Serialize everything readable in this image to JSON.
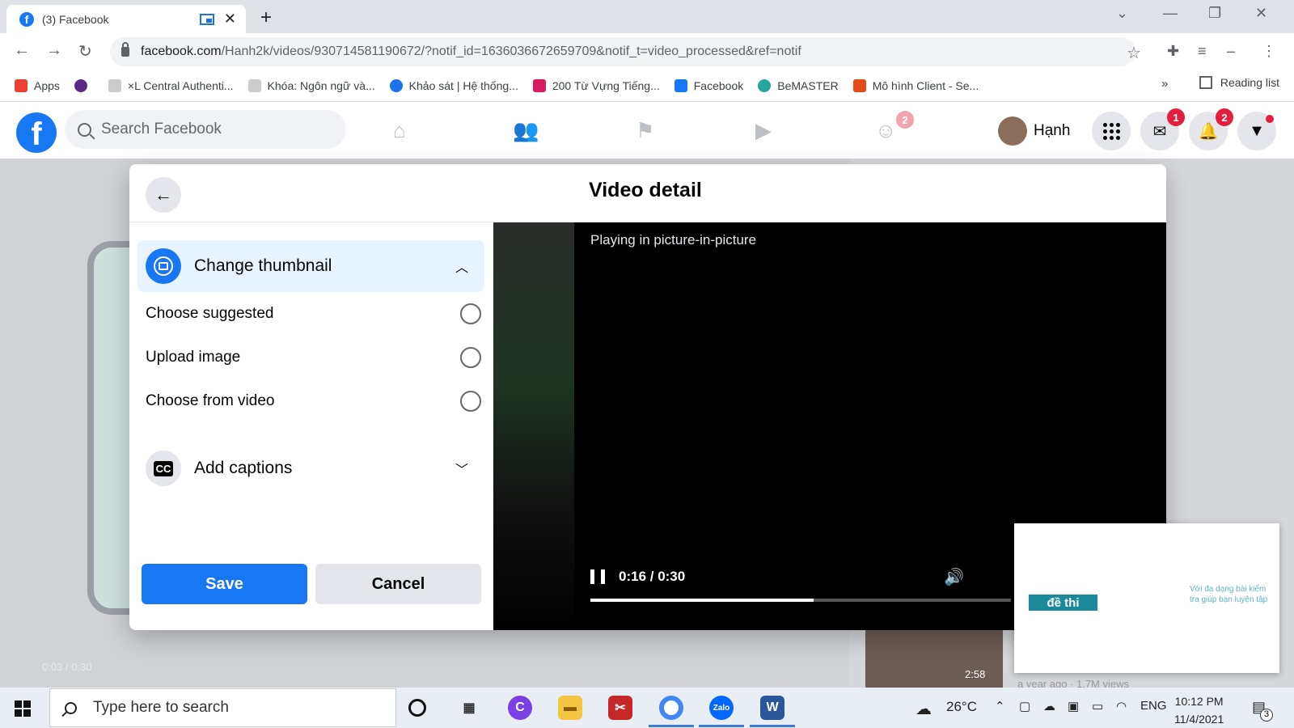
{
  "browser": {
    "tab_title": "(3) Facebook",
    "url_host": "facebook.com",
    "url_path": "/Hanh2k/videos/930714581190672/?notif_id=1636036672659709&notif_t=video_processed&ref=notif",
    "bookmarks": [
      {
        "label": "Apps",
        "color": "#e94235"
      },
      {
        "label": "",
        "color": "#5b2a86"
      },
      {
        "label": "×L Central Authenti...",
        "color": "#ffffff"
      },
      {
        "label": "Khóa: Ngôn ngữ và...",
        "color": "#ffffff"
      },
      {
        "label": "Khảo sát | Hệ thống...",
        "color": "#1a73e8"
      },
      {
        "label": "200 Từ Vựng Tiếng...",
        "color": "#d81b60"
      },
      {
        "label": "Facebook",
        "color": "#1877f2"
      },
      {
        "label": "BeMASTER",
        "color": "#26a69a"
      },
      {
        "label": "Mô hình Client - Se...",
        "color": "#e64a19"
      }
    ],
    "more_bookmarks": "»",
    "reading_list": "Reading list"
  },
  "facebook": {
    "logo": "f",
    "search_placeholder": "Search Facebook",
    "groups_badge": "2",
    "user_name": "Hạnh",
    "messenger_badge": "1",
    "notifications_badge": "2"
  },
  "background": {
    "video_time": "0:03 / 0:30",
    "side_duration": "2:58",
    "side_meta": "a year ago · 1.7M views"
  },
  "modal": {
    "title": "Video detail",
    "thumbnail_section": "Change thumbnail",
    "options": [
      {
        "label": "Choose suggested"
      },
      {
        "label": "Upload image"
      },
      {
        "label": "Choose from video"
      }
    ],
    "captions_section": "Add captions",
    "captions_icon": "CC",
    "save_label": "Save",
    "cancel_label": "Cancel"
  },
  "video": {
    "pip_message": "Playing in picture-in-picture",
    "timecode": "0:16 / 0:30",
    "progress": 0.53
  },
  "pip_window": {
    "tag": "đề thi",
    "text": "Với đa dạng bài kiểm tra giúp bạn luyện tập"
  },
  "taskbar": {
    "search_placeholder": "Type here to search",
    "weather": "26°C",
    "language": "ENG",
    "time": "10:12 PM",
    "date": "11/4/2021",
    "notification_count": "3"
  },
  "colors": {
    "facebook_blue": "#1877f2",
    "badge_red": "#e41e3f",
    "highlight_bg": "#e7f3ff"
  }
}
